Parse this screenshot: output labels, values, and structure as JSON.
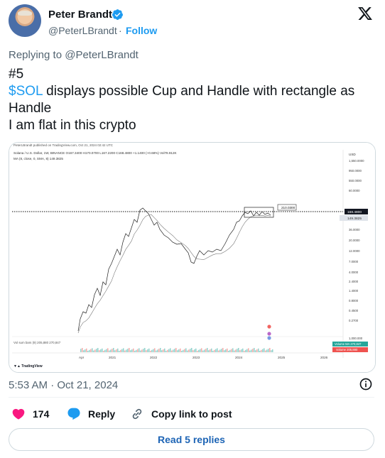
{
  "author": {
    "name": "Peter Brandt",
    "handle": "@PeterLBrandt",
    "separator": "·",
    "follow_label": "Follow"
  },
  "replying_to": "Replying to @PeterLBrandt",
  "tweet": {
    "line1": "#5",
    "cashtag": "$SOL",
    "line2_rest": " displays possible Cup and Handle with rectangle as",
    "line3": "Handle",
    "line4": "I am flat in this crypto"
  },
  "chart": {
    "header": "PeterLBrandt published on TradingView.com, Oct 21, 2024 02:42 UTC",
    "symbol_line": "Solana / U.S. Dollar, 1W, BINANCE  O167.3400  H170.0700  L167.2200  C168.4800  +1.1400 (+0.68%)  Vol78.912K",
    "ma_line": "MA (8, close, 0, SMA, 8)  149.3825",
    "currency": "USD",
    "price_ticks": [
      "1,550.0000",
      "950.0000",
      "550.0000",
      "60.0000",
      "36.0000",
      "20.0000",
      "12.0000",
      "7.0000",
      "4.0000",
      "2.4000",
      "1.4000",
      "0.8000",
      "0.4500",
      "0.2700",
      "1,000.000"
    ],
    "price_label": "168.4800",
    "ma_label": "149.3825",
    "box_label": "210.0300",
    "x_ticks": [
      "Apr",
      "2021",
      "2022",
      "2023",
      "2024",
      "2025",
      "2026"
    ],
    "vol_line": "Vol sum bars (9)  205,880  270,847",
    "vol_badge1": "Volume MA  270,847",
    "vol_badge2": "Volume  205,880",
    "brand": "TradingView",
    "colors": {
      "up": "#26a69a",
      "down": "#ef5350",
      "price_badge": "#131722"
    }
  },
  "timestamp": "5:53 AM · Oct 21, 2024",
  "actions": {
    "likes": "174",
    "reply_label": "Reply",
    "copy_label": "Copy link to post"
  },
  "read_replies": "Read 5 replies"
}
